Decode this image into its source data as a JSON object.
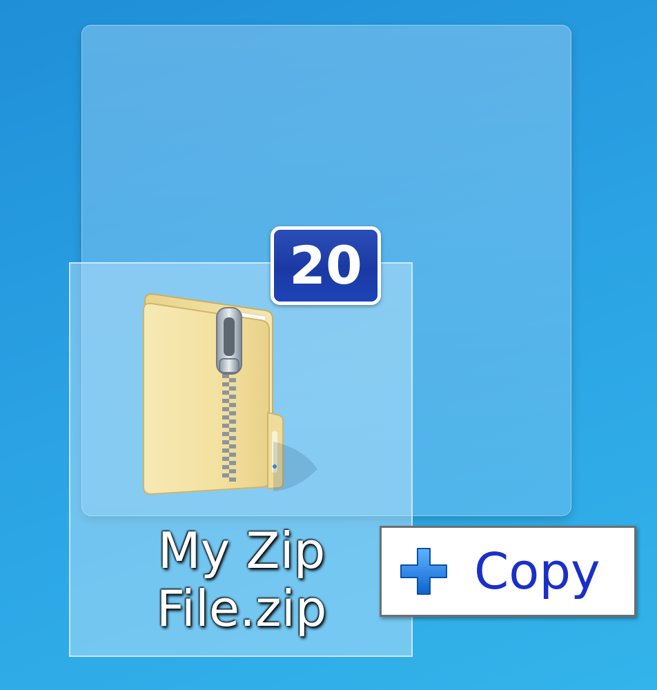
{
  "desktop": {
    "icon": {
      "name_line1": "My Zip",
      "name_line2": "File.zip",
      "icon_type": "zip-folder-icon"
    },
    "drag": {
      "count": "20",
      "action_label": "Copy",
      "action_icon": "plus-icon"
    }
  },
  "colors": {
    "desktop_bg": "#2aa1e3",
    "badge_bg": "#1b39a3",
    "copy_text": "#1a2fc9",
    "plus_icon": "#1177e0"
  }
}
